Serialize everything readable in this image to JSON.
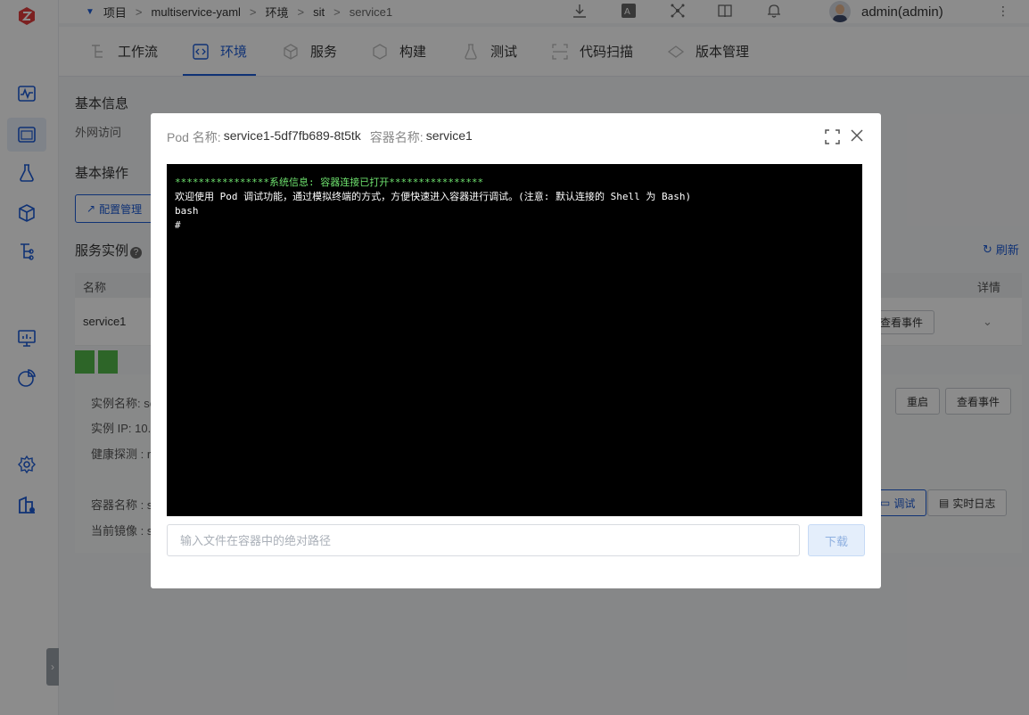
{
  "breadcrumb": {
    "items": [
      "项目",
      "multiservice-yaml",
      "环境",
      "sit",
      "service1"
    ],
    "separator": ">"
  },
  "user": {
    "name": "admin(admin)"
  },
  "tabs": [
    {
      "label": "工作流",
      "icon": "workflow-icon"
    },
    {
      "label": "环境",
      "icon": "code-icon",
      "active": true
    },
    {
      "label": "服务",
      "icon": "cube-icon"
    },
    {
      "label": "构建",
      "icon": "build-icon"
    },
    {
      "label": "测试",
      "icon": "flask-icon"
    },
    {
      "label": "代码扫描",
      "icon": "scan-icon"
    },
    {
      "label": "版本管理",
      "icon": "version-icon"
    }
  ],
  "background": {
    "basic_info_title": "基本信息",
    "external_access_label": "外网访问",
    "basic_ops_title": "基本操作",
    "config_button": "配置管理",
    "service_instances_title": "服务实例",
    "refresh_label": "刷新",
    "table_headers": {
      "name": "名称",
      "details": "详情"
    },
    "row_name": "service1",
    "view_events": "查看事件",
    "detail": {
      "instance_name": "实例名称: se",
      "instance_ip": "实例 IP: 10.2",
      "health_probe": "健康探测 : re",
      "restart": "重启",
      "view_events": "查看事件",
      "container_name": "容器名称 : se",
      "current_image": "当前镜像 : se",
      "debug": "调试",
      "realtime_logs": "实时日志"
    }
  },
  "modal": {
    "pod_label": "Pod 名称:",
    "pod_value": "service1-5df7fb689-8t5tk",
    "container_label": "容器名称:",
    "container_value": "service1",
    "terminal": {
      "system_line": "****************系统信息: 容器连接已打开****************",
      "welcome_line": "欢迎使用 Pod 调试功能，通过模拟终端的方式，方便快速进入容器进行调试。(注意: 默认连接的 Shell 为 Bash)",
      "line3": "bash",
      "prompt": "#"
    },
    "path_placeholder": "输入文件在容器中的绝对路径",
    "download_label": "下载"
  },
  "colors": {
    "accent": "#1d5bd6",
    "terminal_bg": "#000000",
    "system_text": "#6ee16e"
  }
}
